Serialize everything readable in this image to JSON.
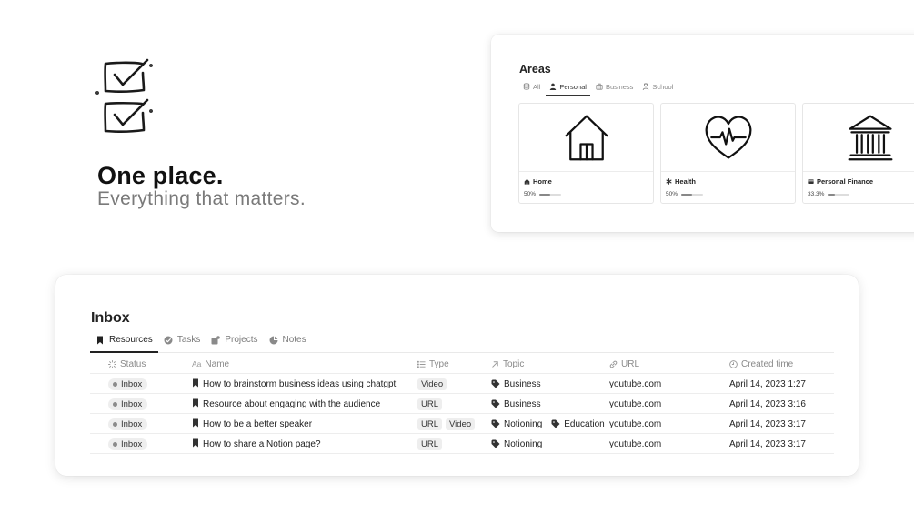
{
  "hero": {
    "title": "One place.",
    "subtitle": "Everything that matters."
  },
  "areas": {
    "title": "Areas",
    "tabs": [
      {
        "label": "All",
        "icon": "stack-icon",
        "active": false
      },
      {
        "label": "Personal",
        "icon": "person-icon",
        "active": true
      },
      {
        "label": "Business",
        "icon": "briefcase-icon",
        "active": false
      },
      {
        "label": "School",
        "icon": "student-icon",
        "active": false
      }
    ],
    "cards": [
      {
        "name": "Home",
        "icon": "house-icon",
        "progress_label": "50%",
        "progress": 0.5
      },
      {
        "name": "Health",
        "icon": "asterisk-icon",
        "progress_label": "50%",
        "progress": 0.5
      },
      {
        "name": "Personal Finance",
        "icon": "card-icon",
        "progress_label": "33.3%",
        "progress": 0.333
      }
    ]
  },
  "inbox": {
    "title": "Inbox",
    "tabs": [
      {
        "label": "Resources",
        "icon": "bookmark-icon",
        "active": true
      },
      {
        "label": "Tasks",
        "icon": "check-circle-icon",
        "active": false
      },
      {
        "label": "Projects",
        "icon": "project-icon",
        "active": false
      },
      {
        "label": "Notes",
        "icon": "note-icon",
        "active": false
      }
    ],
    "columns": {
      "status": "Status",
      "name": "Name",
      "type": "Type",
      "topic": "Topic",
      "url": "URL",
      "created": "Created time"
    },
    "rows": [
      {
        "status": "Inbox",
        "name": "How to brainstorm business ideas using chatgpt",
        "types": [
          "Video"
        ],
        "topics": [
          "Business"
        ],
        "url": "youtube.com",
        "created": "April 14, 2023 1:27"
      },
      {
        "status": "Inbox",
        "name": "Resource about engaging with the audience",
        "types": [
          "URL"
        ],
        "topics": [
          "Business"
        ],
        "url": "youtube.com",
        "created": "April 14, 2023 3:16"
      },
      {
        "status": "Inbox",
        "name": "How to be a better speaker",
        "types": [
          "URL",
          "Video"
        ],
        "topics": [
          "Notioning",
          "Education"
        ],
        "url": "youtube.com",
        "created": "April 14, 2023 3:17"
      },
      {
        "status": "Inbox",
        "name": "How to share a Notion page?",
        "types": [
          "URL"
        ],
        "topics": [
          "Notioning"
        ],
        "url": "youtube.com",
        "created": "April 14, 2023 3:17"
      }
    ]
  }
}
